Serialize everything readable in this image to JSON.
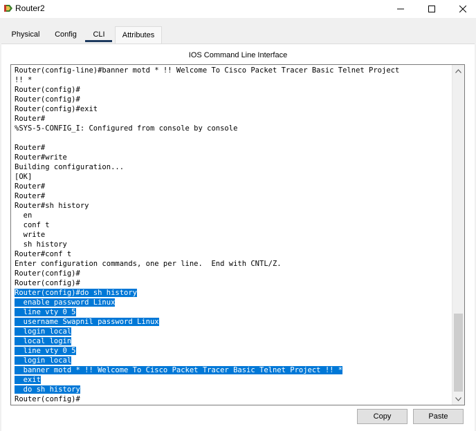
{
  "window": {
    "title": "Router2",
    "app_icon": "packet-tracer-router-icon",
    "controls": [
      "minimize-icon",
      "maximize-icon",
      "close-icon"
    ]
  },
  "tabs": [
    {
      "label": "Physical"
    },
    {
      "label": "Config"
    },
    {
      "label": "CLI",
      "active": true
    },
    {
      "label": "Attributes"
    }
  ],
  "cli": {
    "heading": "IOS Command Line Interface",
    "lines": [
      {
        "text": "Router(config-line)#banner motd * !! Welcome To Cisco Packet Tracer Basic Telnet Project",
        "selected": false
      },
      {
        "text": "!! *",
        "selected": false
      },
      {
        "text": "Router(config)#",
        "selected": false
      },
      {
        "text": "Router(config)#",
        "selected": false
      },
      {
        "text": "Router(config)#exit",
        "selected": false
      },
      {
        "text": "Router#",
        "selected": false
      },
      {
        "text": "%SYS-5-CONFIG_I: Configured from console by console",
        "selected": false
      },
      {
        "text": "",
        "selected": false
      },
      {
        "text": "Router#",
        "selected": false
      },
      {
        "text": "Router#write",
        "selected": false
      },
      {
        "text": "Building configuration...",
        "selected": false
      },
      {
        "text": "[OK]",
        "selected": false
      },
      {
        "text": "Router#",
        "selected": false
      },
      {
        "text": "Router#",
        "selected": false
      },
      {
        "text": "Router#sh history",
        "selected": false
      },
      {
        "text": "  en",
        "selected": false
      },
      {
        "text": "  conf t",
        "selected": false
      },
      {
        "text": "  write",
        "selected": false
      },
      {
        "text": "  sh history",
        "selected": false
      },
      {
        "text": "Router#conf t",
        "selected": false
      },
      {
        "text": "Enter configuration commands, one per line.  End with CNTL/Z.",
        "selected": false
      },
      {
        "text": "Router(config)#",
        "selected": false
      },
      {
        "text": "Router(config)#",
        "selected": false
      },
      {
        "text": "Router(config)#do sh history",
        "selected": true
      },
      {
        "text": "  enable password Linux",
        "selected": true
      },
      {
        "text": "  line vty 0 5",
        "selected": true
      },
      {
        "text": "  username Swapnil password Linux",
        "selected": true
      },
      {
        "text": "  login local",
        "selected": true
      },
      {
        "text": "  local login",
        "selected": true
      },
      {
        "text": "  line vty 0 5",
        "selected": true
      },
      {
        "text": "  login local",
        "selected": true
      },
      {
        "text": "  banner motd * !! Welcome To Cisco Packet Tracer Basic Telnet Project !! *",
        "selected": true
      },
      {
        "text": "  exit",
        "selected": true
      },
      {
        "text": "  do sh history",
        "selected": true
      },
      {
        "text": "Router(config)#",
        "selected": false
      }
    ],
    "scroll_up_icon": "chevron-up-icon",
    "scroll_down_icon": "chevron-down-icon"
  },
  "buttons": {
    "copy": "Copy",
    "paste": "Paste"
  },
  "colors": {
    "selection": "#0078d7",
    "active_tab_underline": "#1e3a5f"
  }
}
